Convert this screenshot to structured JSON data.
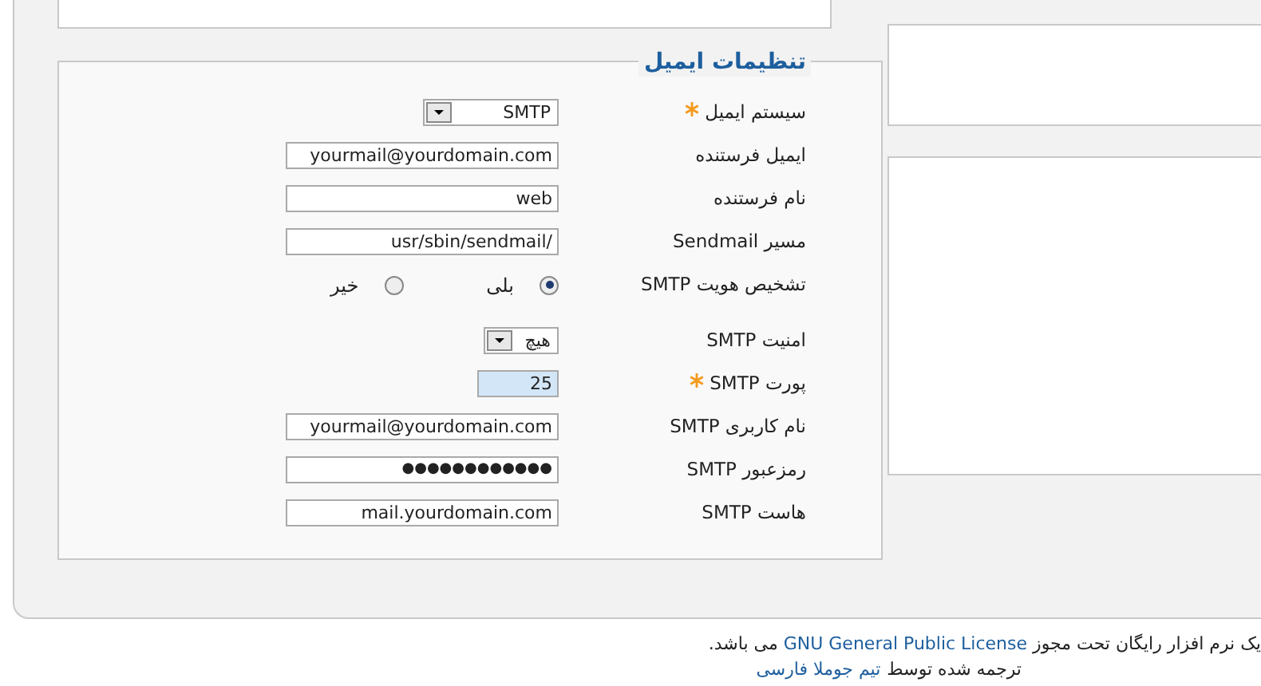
{
  "email_settings": {
    "legend": "تنظیمات ایمیل",
    "fields": [
      {
        "kind": "select",
        "label": "سیستم ایمیل",
        "required": true,
        "highlighted": false,
        "value": "SMTP"
      },
      {
        "kind": "text",
        "label": "ایمیل فرستنده",
        "required": false,
        "highlighted": false,
        "value": "yourmail@yourdomain.com"
      },
      {
        "kind": "text",
        "label": "نام فرستنده",
        "required": false,
        "highlighted": false,
        "value": "web"
      },
      {
        "kind": "text",
        "label": "مسیر Sendmail",
        "required": false,
        "highlighted": false,
        "value": "usr/sbin/sendmail/"
      },
      {
        "kind": "radio",
        "label": "تشخیص هویت SMTP",
        "required": false,
        "options": [
          {
            "label": "بلی",
            "selected": true
          },
          {
            "label": "خیر",
            "selected": false
          }
        ]
      },
      {
        "kind": "select",
        "label": "امنیت SMTP",
        "required": false,
        "highlighted": false,
        "value": "هیچ"
      },
      {
        "kind": "text",
        "label": "پورت SMTP",
        "required": true,
        "highlighted": true,
        "value": "25"
      },
      {
        "kind": "text",
        "label": "نام کاربری SMTP",
        "required": false,
        "highlighted": false,
        "value": "yourmail@yourdomain.com"
      },
      {
        "kind": "password",
        "label": "رمزعبور SMTP",
        "required": false,
        "highlighted": false,
        "value": "●●●●●●●●●●●●"
      },
      {
        "kind": "text",
        "label": "هاست SMTP",
        "required": false,
        "highlighted": false,
        "value": "mail.yourdomain.com"
      }
    ]
  },
  "footer": {
    "license": "یک نرم افزار رایگان تحت مجوز **GNU General Public License** می باشد.",
    "credit_prefix": "ترجمه شده توسط",
    "credit_link": "تیم جوملا فارسی"
  }
}
